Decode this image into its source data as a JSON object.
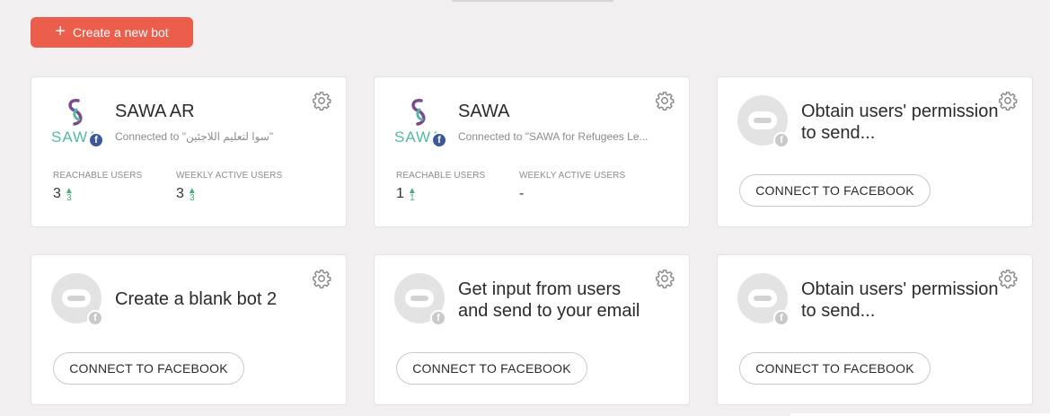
{
  "toolbar": {
    "create_label": "Create a new bot"
  },
  "colors": {
    "accent": "#ea5e4b",
    "delta_green": "#45b07c",
    "facebook": "#3b5998"
  },
  "bots": [
    {
      "name": "SAWA AR",
      "connected_text": "Connected to \"سوا لتعليم اللاجئين\"",
      "logo_text": "SAWA",
      "stats": {
        "reachable_label": "REACHABLE USERS",
        "reachable_value": "3",
        "reachable_delta": "3",
        "weekly_label": "WEEKLY ACTIVE USERS",
        "weekly_value": "3",
        "weekly_delta": "3"
      }
    },
    {
      "name": "SAWA",
      "connected_text": "Connected to \"SAWA for Refugees Le...",
      "logo_text": "SAWA",
      "stats": {
        "reachable_label": "REACHABLE USERS",
        "reachable_value": "1",
        "reachable_delta": "1",
        "weekly_label": "WEEKLY ACTIVE USERS",
        "weekly_value": "-"
      }
    },
    {
      "name": "Obtain users' permission to send...",
      "connect_label": "CONNECT TO FACEBOOK"
    },
    {
      "name": "Create a blank bot 2",
      "connect_label": "CONNECT TO FACEBOOK"
    },
    {
      "name": "Get input from users and send to your email",
      "connect_label": "CONNECT TO FACEBOOK"
    },
    {
      "name": "Obtain users' permission to send...",
      "connect_label": "CONNECT TO FACEBOOK"
    }
  ],
  "icons": {
    "gear": "gear-icon",
    "robot": "robot-icon",
    "facebook": "facebook-icon",
    "plus": "plus-icon",
    "delta": "arrow-up-icon"
  }
}
